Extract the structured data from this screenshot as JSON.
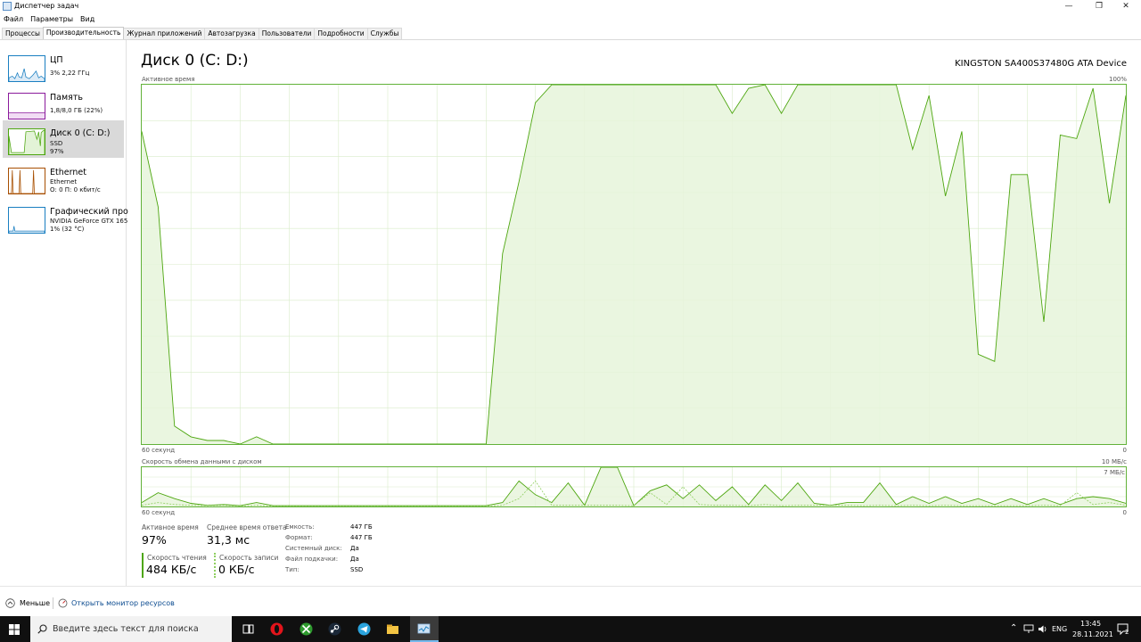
{
  "window": {
    "title": "Диспетчер задач",
    "controls": {
      "minimize": "—",
      "maximize": "❐",
      "close": "✕"
    }
  },
  "menu": [
    "Файл",
    "Параметры",
    "Вид"
  ],
  "tabs": [
    {
      "label": "Процессы",
      "active": false
    },
    {
      "label": "Производительность",
      "active": true
    },
    {
      "label": "Журнал приложений",
      "active": false
    },
    {
      "label": "Автозагрузка",
      "active": false
    },
    {
      "label": "Пользователи",
      "active": false
    },
    {
      "label": "Подробности",
      "active": false
    },
    {
      "label": "Службы",
      "active": false
    }
  ],
  "sidebar": {
    "items": [
      {
        "title": "ЦП",
        "line1": "3% 2,22 ГГц",
        "line2": "",
        "color": "#1a7fc1",
        "icon": "cpu-graph-icon"
      },
      {
        "title": "Память",
        "line1": "1,8/8,0 ГБ (22%)",
        "line2": "",
        "color": "#8b1a9c",
        "icon": "memory-graph-icon"
      },
      {
        "title": "Диск 0 (C: D:)",
        "line1": "SSD",
        "line2": "97%",
        "color": "#4da60f",
        "icon": "disk-graph-icon"
      },
      {
        "title": "Ethernet",
        "line1": "Ethernet",
        "line2": "О: 0 П: 0 кбит/с",
        "color": "#a74f01",
        "icon": "ethernet-graph-icon"
      },
      {
        "title": "Графический про",
        "line1": "NVIDIA GeForce GTX 165",
        "line2": "1% (32 °C)",
        "color": "#1a7fc1",
        "icon": "gpu-graph-icon"
      }
    ]
  },
  "main": {
    "title": "Диск 0 (C: D:)",
    "device": "KINGSTON SA400S37480G ATA Device",
    "active_graph": {
      "label": "Активное время",
      "max_label": "100%",
      "x_left_label": "60 секунд",
      "x_right_label": "0"
    },
    "transfer_graph": {
      "label": "Скорость обмена данными с диском",
      "max_label": "10 МБ/с",
      "inner_label": "7 МБ/с",
      "x_left_label": "60 секунд",
      "x_right_label": "0"
    },
    "stats": {
      "active_time_label": "Активное время",
      "active_time_value": "97%",
      "avg_response_label": "Среднее время ответа",
      "avg_response_value": "31,3 мс",
      "read_speed_label": "Скорость чтения",
      "read_speed_value": "484 КБ/с",
      "write_speed_label": "Скорость записи",
      "write_speed_value": "0 КБ/с"
    },
    "properties": [
      {
        "key": "Емкость:",
        "value": "447 ГБ"
      },
      {
        "key": "Формат:",
        "value": "447 ГБ"
      },
      {
        "key": "Системный диск:",
        "value": "Да"
      },
      {
        "key": "Файл подкачки:",
        "value": "Да"
      },
      {
        "key": "Тип:",
        "value": "SSD"
      }
    ]
  },
  "footer": {
    "less_label": "Меньше",
    "monitor_link": "Открыть монитор ресурсов"
  },
  "taskbar": {
    "search_placeholder": "Введите здесь текст для поиска",
    "lang": "ENG",
    "time": "13:45",
    "date": "28.11.2021",
    "notifications": "2"
  },
  "chart_data": [
    {
      "type": "area",
      "title": "Активное время",
      "ylabel": "",
      "xlabel": "60 секунд",
      "ylim": [
        0,
        100
      ],
      "xlim": [
        60,
        0
      ],
      "grid": true,
      "x": [
        60,
        59,
        58,
        57,
        56,
        55,
        54,
        53,
        52,
        51,
        50,
        49,
        48,
        47,
        46,
        45,
        44,
        43,
        42,
        41,
        40,
        39,
        38,
        37,
        36,
        35,
        34,
        33,
        32,
        31,
        30,
        29,
        28,
        27,
        26,
        25,
        24,
        23,
        22,
        21,
        20,
        19,
        18,
        17,
        16,
        15,
        14,
        13,
        12,
        11,
        10,
        9,
        8,
        7,
        6,
        5,
        4,
        3,
        2,
        1,
        0
      ],
      "values": [
        87,
        66,
        5,
        2,
        1,
        1,
        0,
        2,
        0,
        0,
        0,
        0,
        0,
        0,
        0,
        0,
        0,
        0,
        0,
        0,
        0,
        0,
        53,
        73,
        95,
        100,
        100,
        100,
        100,
        100,
        100,
        100,
        100,
        100,
        100,
        100,
        92,
        99,
        100,
        92,
        100,
        100,
        100,
        100,
        100,
        100,
        100,
        82,
        97,
        69,
        87,
        25,
        23,
        75,
        75,
        34,
        86,
        85,
        99,
        67,
        97
      ],
      "series_color": "#4da60f"
    },
    {
      "type": "line",
      "title": "Скорость обмена данными с диском",
      "ylim": [
        0,
        10
      ],
      "xlim": [
        60,
        0
      ],
      "series": [
        {
          "name": "",
          "values": [
            1.0,
            3.5,
            2.0,
            0.8,
            0.3,
            0.5,
            0.2,
            1.0,
            0.2,
            0.2,
            0.2,
            0.2,
            0.2,
            0.2,
            0.2,
            0.2,
            0.2,
            0.2,
            0.2,
            0.2,
            0.2,
            0.2,
            1.0,
            6.5,
            3.0,
            1.0,
            6.0,
            0.3,
            10,
            10,
            0.2,
            4.0,
            5.5,
            2.0,
            5.5,
            1.5,
            5.0,
            0.5,
            5.5,
            1.5,
            6.0,
            0.8,
            0.3,
            1.0,
            1.0,
            6.0,
            0.5,
            2.5,
            0.8,
            2.5,
            0.8,
            2.0,
            0.5,
            2.0,
            0.5,
            2.0,
            0.5,
            2.0,
            2.5,
            2.0,
            0.8
          ]
        },
        {
          "name": "",
          "values": [
            0.3,
            1.0,
            0.5,
            0.3,
            0.2,
            0.3,
            0.1,
            0.3,
            0.1,
            0.1,
            0.1,
            0.1,
            0.1,
            0.1,
            0.1,
            0.1,
            0.1,
            0.1,
            0.1,
            0.1,
            0.1,
            0.1,
            0.3,
            2.0,
            6.5,
            0.3,
            0.3,
            0.3,
            0.3,
            0.3,
            0.2,
            3.5,
            0.5,
            5.0,
            0.5,
            0.3,
            0.3,
            0.2,
            0.5,
            0.2,
            0.3,
            0.3,
            0.3,
            0.3,
            0.2,
            0.3,
            0.2,
            0.3,
            0.2,
            0.3,
            0.2,
            0.2,
            0.2,
            0.2,
            0.2,
            0.3,
            0.2,
            3.5,
            0.5,
            1.0,
            0.3
          ]
        }
      ],
      "series_color": "#4da60f"
    }
  ]
}
